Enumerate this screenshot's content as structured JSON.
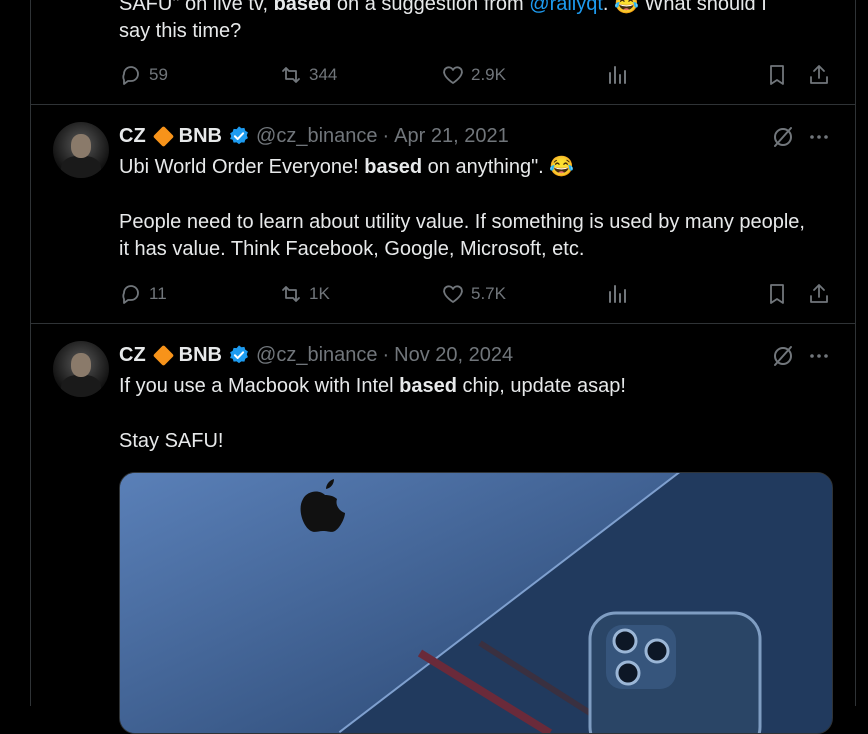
{
  "tweet0": {
    "text_line1_pre": "SAFU\" on live tv, ",
    "text_bold": "based",
    "text_line1_mid": " on a suggestion from ",
    "mention": "@rallyqt",
    "text_line1_post": ". 😂 What should I",
    "text_line2": "say this time?",
    "replies": "59",
    "retweets": "344",
    "likes": "2.9K"
  },
  "tweet1": {
    "name": "CZ",
    "name2": "BNB",
    "handle": "@cz_binance",
    "date": "Apr 21, 2021",
    "text_pre": "Ubi World Order Everyone! ",
    "text_bold": "based",
    "text_post": " on anything\". 😂",
    "text_para2": "People need to learn about utility value. If something is used by many people, it has value. Think Facebook, Google, Microsoft, etc.",
    "replies": "11",
    "retweets": "1K",
    "likes": "5.7K"
  },
  "tweet2": {
    "name": "CZ",
    "name2": "BNB",
    "handle": "@cz_binance",
    "date": "Nov 20, 2024",
    "text_pre": "If you use a Macbook with Intel ",
    "text_bold": "based",
    "text_post": " chip, update asap!",
    "text_para2": "Stay SAFU!"
  },
  "colors": {
    "background": "#000000",
    "text": "#e7e9ea",
    "muted": "#71767b",
    "accent": "#1d9bf0",
    "border": "#2f3336"
  }
}
